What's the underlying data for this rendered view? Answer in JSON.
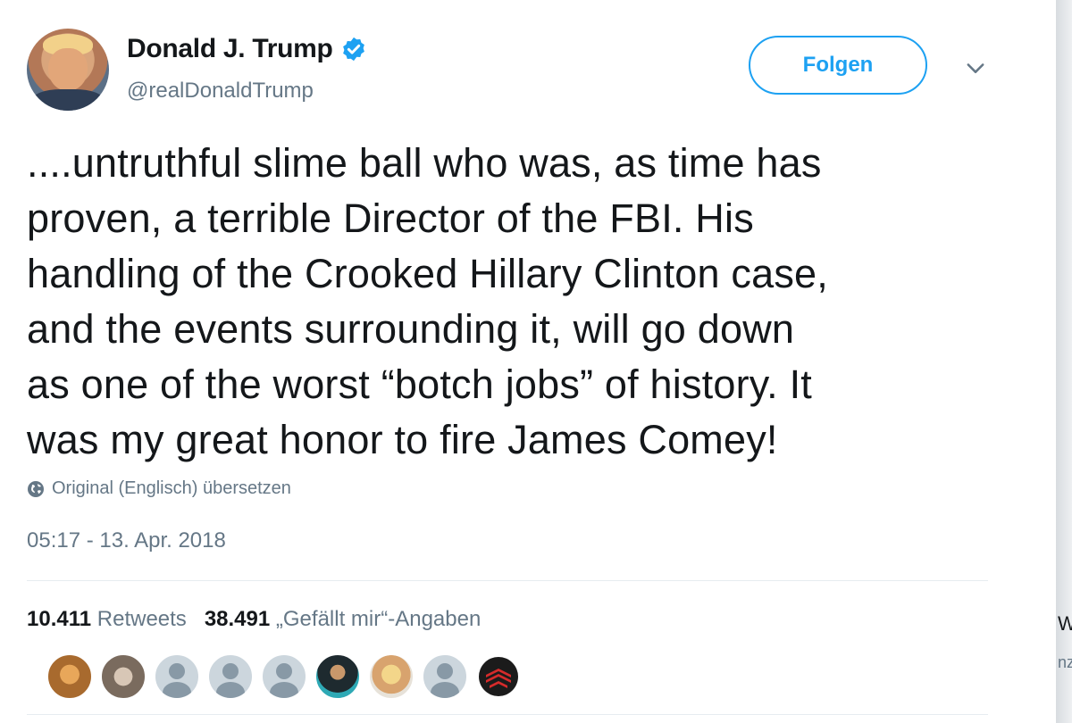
{
  "tweet": {
    "author_name": "Donald J. Trump",
    "handle": "@realDonaldTrump",
    "follow_label": "Folgen",
    "text": "....untruthful slime ball who was, as time has\nproven, a terrible Director of the FBI. His\nhandling of the Crooked Hillary Clinton case,\nand the events surrounding it, will go down\nas one of the worst “botch jobs” of history. It\nwas my great honor to fire James Comey!",
    "translate_label": "Original (Englisch) übersetzen",
    "timestamp": "05:17 - 13. Apr. 2018",
    "retweet_count": "10.411",
    "retweet_label": "Retweets",
    "like_count": "38.491",
    "like_label": "„Gefällt mir“-Angaben"
  },
  "side": {
    "fragment_w": "W",
    "fragment_nz": "nz"
  },
  "icons": [
    "verified-icon",
    "chevron-down-icon",
    "globe-icon"
  ],
  "colors": {
    "accent": "#1da1f2",
    "secondary_text": "#657786",
    "primary_text": "#14171a",
    "divider": "#e6ecf0"
  }
}
